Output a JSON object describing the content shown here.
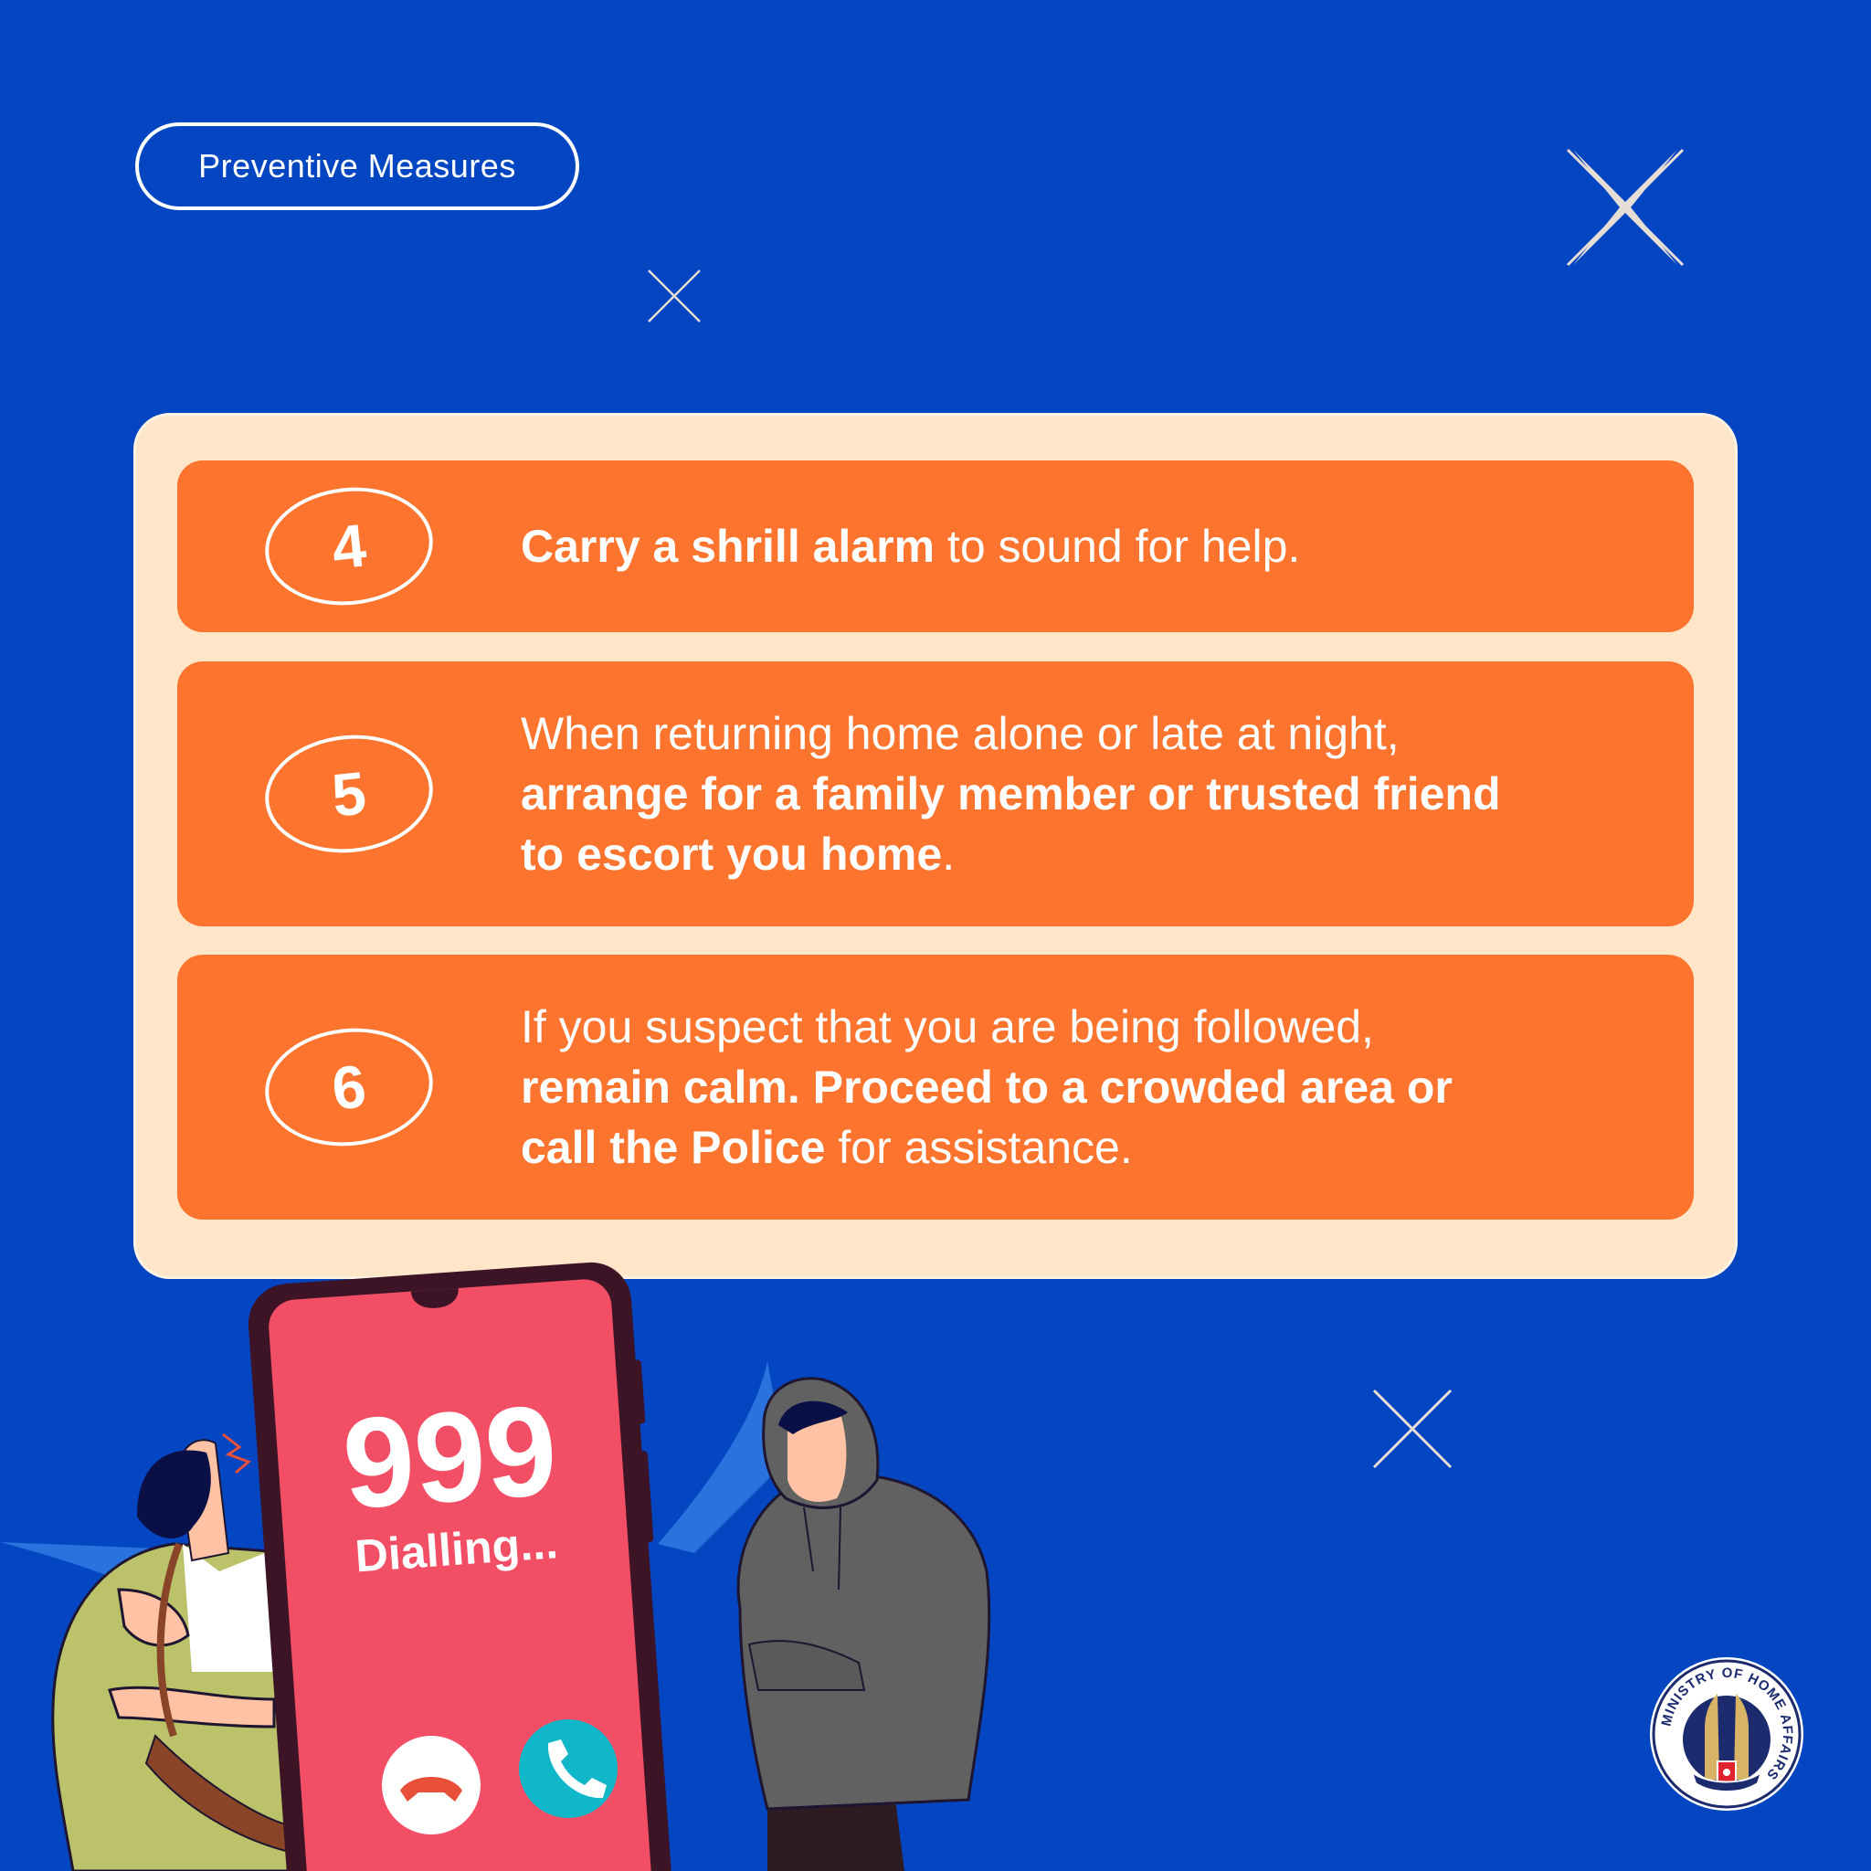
{
  "header": {
    "tag_label": "Preventive Measures"
  },
  "measures": [
    {
      "number": "4",
      "parts": [
        {
          "text": "Carry a shrill alarm",
          "bold": true
        },
        {
          "text": " to sound for help.",
          "bold": false
        }
      ]
    },
    {
      "number": "5",
      "parts": [
        {
          "text": "When returning home alone or late at night,",
          "bold": false
        },
        {
          "text": "arrange for a family member or trusted friend",
          "bold": true
        },
        {
          "text": "to escort you home",
          "bold": true
        },
        {
          "text": ".",
          "bold": false
        }
      ]
    },
    {
      "number": "6",
      "parts": [
        {
          "text": "If you suspect that you are being followed,",
          "bold": false
        },
        {
          "text": "remain calm. Proceed to a crowded area or",
          "bold": true
        },
        {
          "text": "call the Police",
          "bold": true
        },
        {
          "text": " for assistance.",
          "bold": false
        }
      ]
    }
  ],
  "phone": {
    "number": "999",
    "status": "Dialling..."
  },
  "logo": {
    "ring_text": "MINISTRY OF HOME AFFAIRS"
  },
  "colors": {
    "background": "#0446c2",
    "panel": "#ffe6c9",
    "row": "#fc742e",
    "phone_screen": "#f24f66",
    "phone_frame": "#3d1426",
    "accept_button": "#10b7c9"
  },
  "icons": [
    "sparkle-icon",
    "decline-call-icon",
    "accept-call-icon",
    "ministry-crest-logo"
  ]
}
